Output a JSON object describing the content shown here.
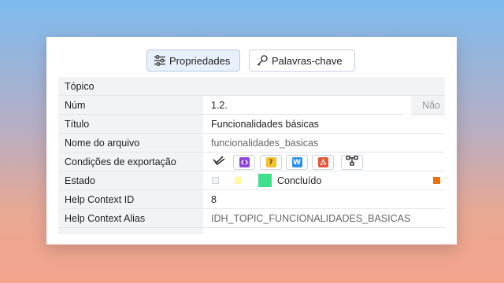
{
  "tabs": [
    {
      "label": "Propriedades",
      "icon": "sliders-icon",
      "active": true
    },
    {
      "label": "Palavras-chave",
      "icon": "key-icon",
      "active": false
    }
  ],
  "properties": {
    "topico": {
      "label": "Tópico"
    },
    "num": {
      "label": "Núm",
      "value": "1.2.",
      "suffix": "Não"
    },
    "titulo": {
      "label": "Título",
      "value": "Funcionalidades básicas"
    },
    "arquivo": {
      "label": "Nome do arquivo",
      "value": "funcionalidades_basicas"
    },
    "exportacao": {
      "label": "Condições de exportação",
      "buttons": [
        {
          "icon": "check-all-icon",
          "color": "#333333"
        },
        {
          "icon": "code-icon",
          "color": "#8e44d8"
        },
        {
          "icon": "help-question-icon",
          "color": "#f2c12e"
        },
        {
          "icon": "word-icon",
          "color": "#2b8fe8"
        },
        {
          "icon": "pdf-icon",
          "color": "#e8553d"
        },
        {
          "icon": "workflow-icon",
          "color": "#333333"
        }
      ]
    },
    "estado": {
      "label": "Estado",
      "value": "Concluído",
      "color": "#3ee08c",
      "end_color": "#f07010"
    },
    "help_id": {
      "label": "Help Context ID",
      "value": "8"
    },
    "help_alias": {
      "label": "Help Context Alias",
      "value": "IDH_TOPIC_FUNCIONALIDADES_BASICAS"
    }
  }
}
